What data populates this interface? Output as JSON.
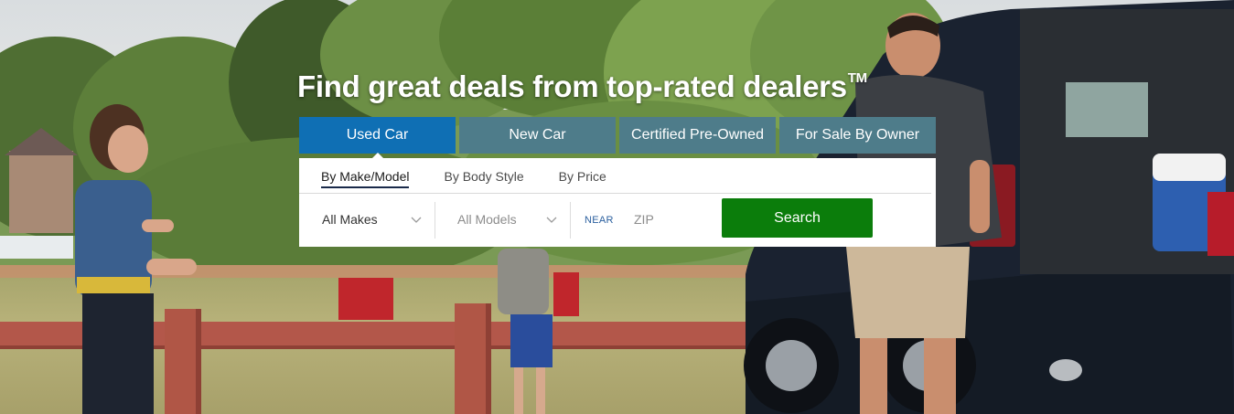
{
  "hero": {
    "headline": "Find great deals from top-rated dealers",
    "trademark": "TM"
  },
  "tabs": [
    {
      "label": "Used Car",
      "active": true
    },
    {
      "label": "New Car",
      "active": false
    },
    {
      "label": "Certified Pre-Owned",
      "active": false
    },
    {
      "label": "For Sale By Owner",
      "active": false
    }
  ],
  "subtabs": [
    {
      "label": "By Make/Model",
      "active": true
    },
    {
      "label": "By Body Style",
      "active": false
    },
    {
      "label": "By Price",
      "active": false
    }
  ],
  "form": {
    "make_value": "All Makes",
    "model_value": "All Models",
    "near_label": "NEAR",
    "zip_placeholder": "ZIP",
    "search_label": "Search"
  },
  "colors": {
    "active_tab": "#0f6fb4",
    "inactive_tab": "#4e7c8a",
    "search_button": "#0b7d0b"
  }
}
